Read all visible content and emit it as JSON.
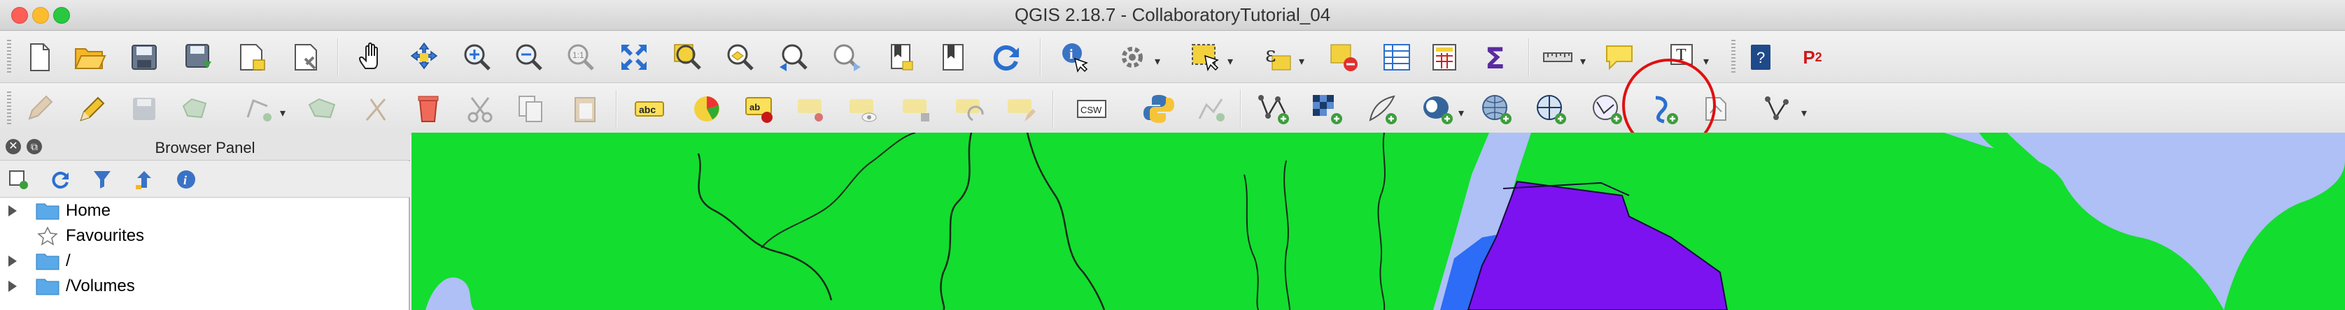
{
  "window": {
    "title": "QGIS 2.18.7 - CollaboratoryTutorial_04"
  },
  "toolbar1": {
    "icons": [
      "new-project-icon",
      "open-project-icon",
      "save-project-icon",
      "save-as-icon",
      "new-print-composer-icon",
      "composer-manager-icon",
      "pan-icon",
      "pan-to-selection-icon",
      "zoom-in-icon",
      "zoom-out-icon",
      "zoom-native-icon",
      "zoom-full-icon",
      "zoom-to-selection-icon",
      "zoom-to-layer-icon",
      "zoom-last-icon",
      "zoom-next-icon",
      "new-bookmark-icon",
      "show-bookmarks-icon",
      "refresh-icon",
      "identify-icon",
      "run-action-icon",
      "select-features-icon",
      "select-by-expression-icon",
      "deselect-icon",
      "open-attribute-table-icon",
      "field-calculator-icon",
      "statistical-summary-icon",
      "measure-icon",
      "map-tips-icon",
      "text-annotation-icon",
      "help-icon",
      "plugin-p2-icon"
    ],
    "text_annotation": "T",
    "p2_label": "P",
    "p2_super": "2"
  },
  "toolbar2": {
    "icons": [
      "digitize-pencil-icon",
      "toggle-editing-icon",
      "save-edits-icon",
      "add-feature-icon",
      "move-feature-icon",
      "node-tool-icon",
      "delete-selected-icon",
      "cut-features-icon",
      "copy-features-icon",
      "paste-features-icon",
      "layer-labeling-icon",
      "layer-diagram-icon",
      "pin-labels-icon",
      "highlight-pinned-icon",
      "show-hide-labels-icon",
      "move-label-icon",
      "rotate-label-icon",
      "change-label-icon",
      "csw-icon",
      "python-console-icon",
      "georeferencer-icon",
      "add-vector-layer-icon",
      "add-raster-layer-icon",
      "add-delimited-text-icon",
      "add-postgis-icon",
      "add-spatialite-icon",
      "add-wms-icon",
      "add-wcs-icon",
      "add-wfs-icon",
      "new-gpx-layer-icon",
      "new-shapefile-icon",
      "new-temporary-layer-icon"
    ],
    "abc_label": "abc",
    "csw_label": "CSW"
  },
  "browser_panel": {
    "title": "Browser Panel",
    "close_glyph": "✕",
    "float_glyph": "⧉",
    "tools": [
      "add-selected-layers-icon",
      "refresh-icon",
      "filter-icon",
      "collapse-all-icon",
      "info-icon"
    ],
    "items": [
      {
        "label": "Home",
        "icon": "folder-icon",
        "expandable": true
      },
      {
        "label": "Favourites",
        "icon": "star-icon",
        "expandable": false
      },
      {
        "label": "/",
        "icon": "folder-icon",
        "expandable": true
      },
      {
        "label": "/Volumes",
        "icon": "folder-icon",
        "expandable": true
      }
    ]
  },
  "colors": {
    "land": "#13dd2f",
    "water": "#aec0f5",
    "admin_purple": "#7c12f0",
    "admin_blue": "#2c6cf6",
    "highlight_circle": "#e01010"
  }
}
